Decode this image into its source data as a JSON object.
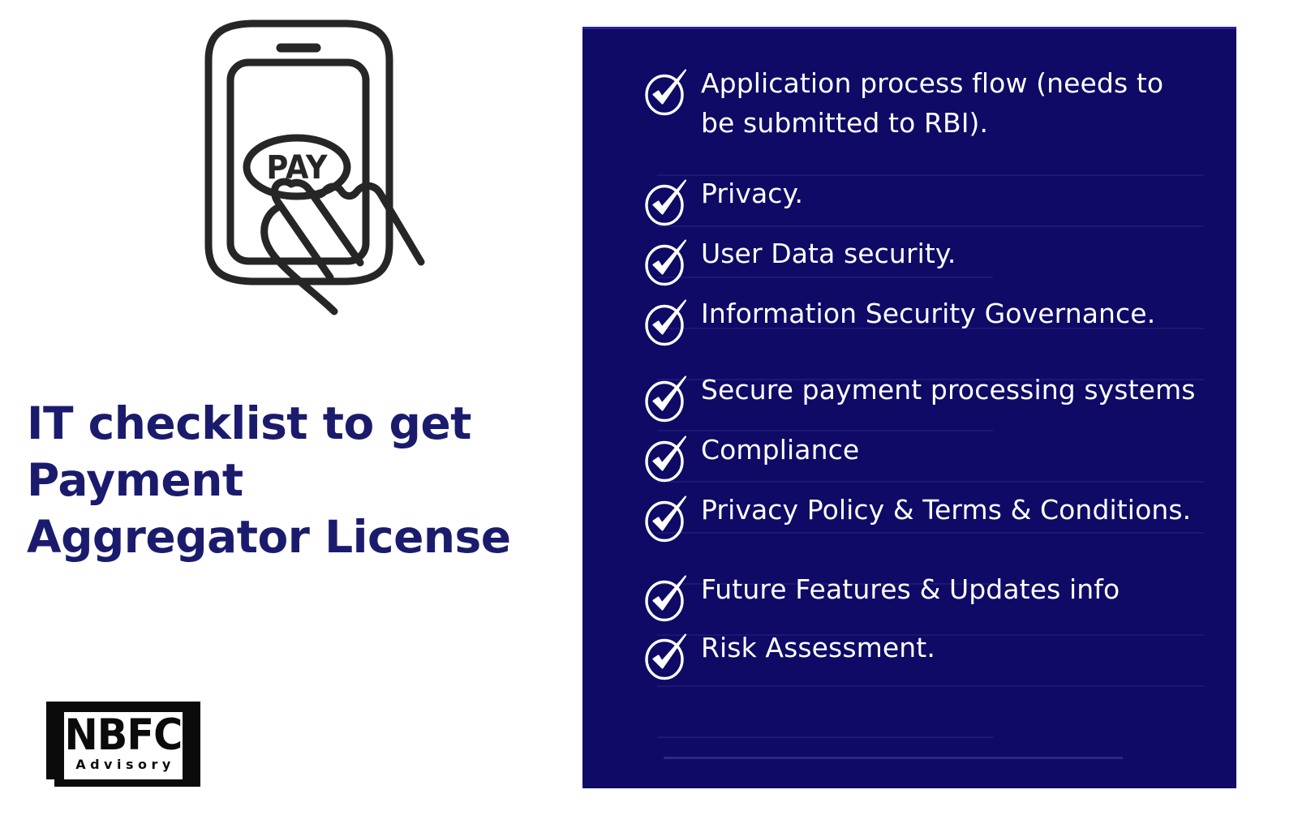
{
  "headline": {
    "text": "IT checklist to get\nPayment\nAggregator License",
    "color": "#1b1b6e"
  },
  "illustration": {
    "name": "pay-phone-hand-illustration",
    "button_label": "PAY",
    "stroke_color": "#262626"
  },
  "logo": {
    "primary": "NBFC",
    "secondary": "Advisory",
    "color": "#0b0b0b"
  },
  "panel": {
    "background_color": "#0e0a66",
    "text_color": "#ffffff",
    "icon_name": "check-circle-icon"
  },
  "checklist": {
    "items": [
      {
        "label": "Application process flow (needs to be submitted to RBI)."
      },
      {
        "label": "Privacy."
      },
      {
        "label": "User Data security."
      },
      {
        "label": "Information Security Governance."
      },
      {
        "label": "Secure payment processing systems"
      },
      {
        "label": "Compliance"
      },
      {
        "label": "Privacy Policy & Terms & Conditions."
      },
      {
        "label": "Future Features & Updates info"
      },
      {
        "label": "Risk Assessment."
      }
    ],
    "item_gaps": [
      38,
      8,
      8,
      28,
      8,
      8,
      32,
      6
    ]
  }
}
